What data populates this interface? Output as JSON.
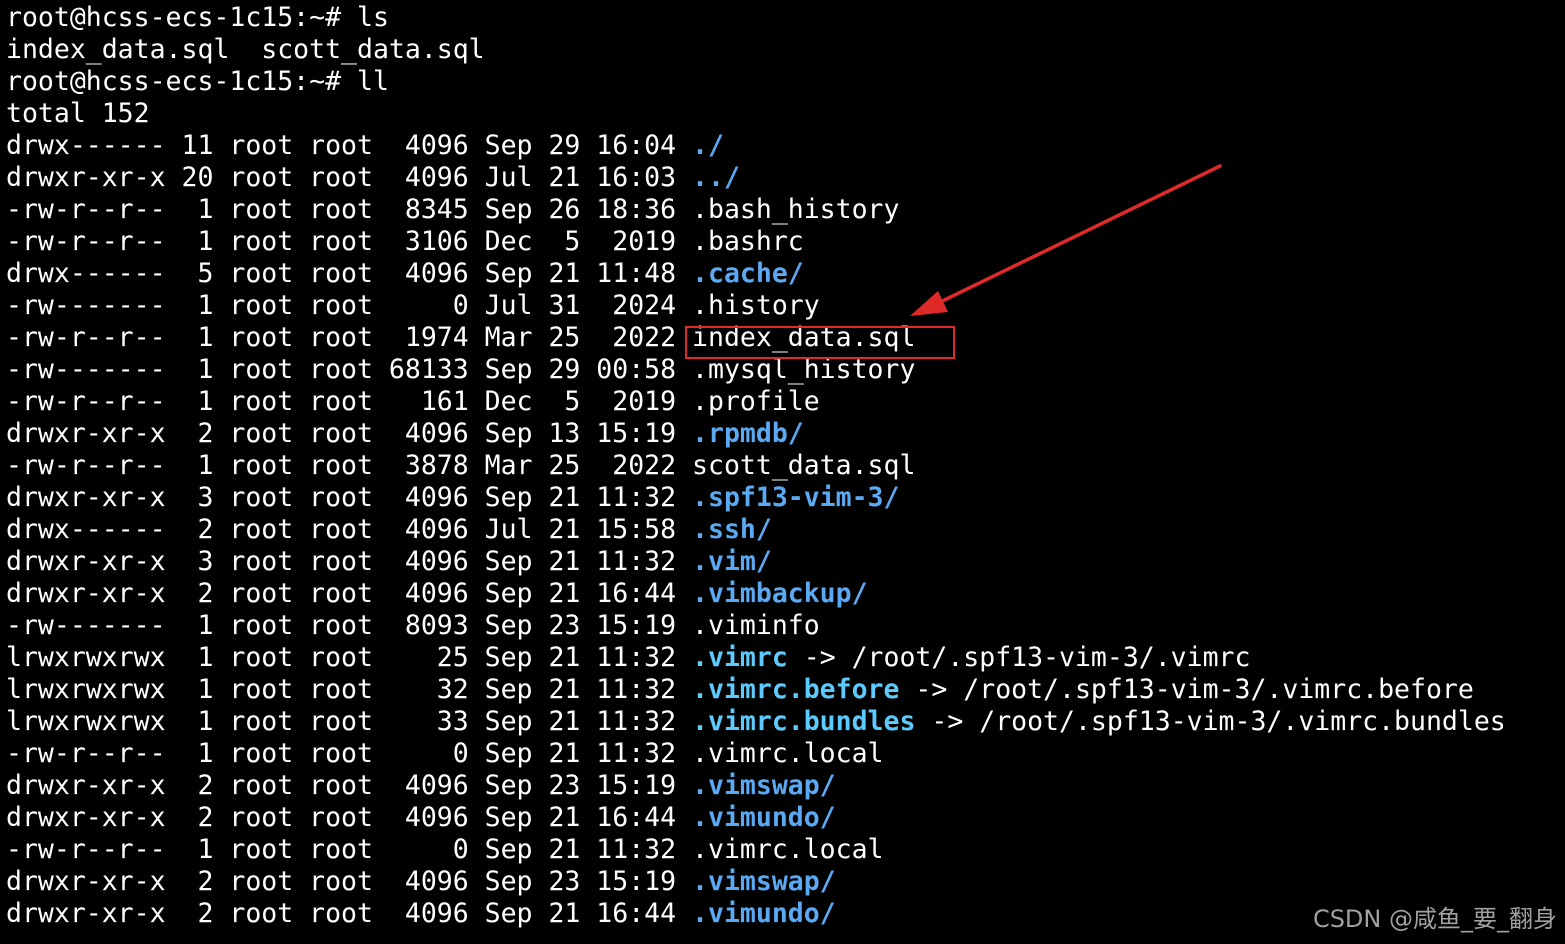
{
  "terminal": {
    "lines": [
      {
        "text": "root@hcss-ecs-1c15:~# ls"
      },
      {
        "text": "index_data.sql  scott_data.sql"
      },
      {
        "text": "root@hcss-ecs-1c15:~# ll"
      },
      {
        "text": "total 152"
      },
      {
        "meta": "drwx------ 11 root root  4096 Sep 29 16:04 ",
        "name": "./",
        "kind": "dir"
      },
      {
        "meta": "drwxr-xr-x 20 root root  4096 Jul 21 16:03 ",
        "name": "../",
        "kind": "dir"
      },
      {
        "meta": "-rw-r--r--  1 root root  8345 Sep 26 18:36 ",
        "name": ".bash_history",
        "kind": "file"
      },
      {
        "meta": "-rw-r--r--  1 root root  3106 Dec  5  2019 ",
        "name": ".bashrc",
        "kind": "file"
      },
      {
        "meta": "drwx------  5 root root  4096 Sep 21 11:48 ",
        "name": ".cache/",
        "kind": "dir"
      },
      {
        "meta": "-rw-------  1 root root     0 Jul 31  2024 ",
        "name": ".history",
        "kind": "file"
      },
      {
        "meta": "-rw-r--r--  1 root root  1974 Mar 25  2022 ",
        "name": "index_data.sql",
        "kind": "file"
      },
      {
        "meta": "-rw-------  1 root root 68133 Sep 29 00:58 ",
        "name": ".mysql_history",
        "kind": "file"
      },
      {
        "meta": "-rw-r--r--  1 root root   161 Dec  5  2019 ",
        "name": ".profile",
        "kind": "file"
      },
      {
        "meta": "drwxr-xr-x  2 root root  4096 Sep 13 15:19 ",
        "name": ".rpmdb/",
        "kind": "dir"
      },
      {
        "meta": "-rw-r--r--  1 root root  3878 Mar 25  2022 ",
        "name": "scott_data.sql",
        "kind": "file"
      },
      {
        "meta": "drwxr-xr-x  3 root root  4096 Sep 21 11:32 ",
        "name": ".spf13-vim-3/",
        "kind": "dir"
      },
      {
        "meta": "drwx------  2 root root  4096 Jul 21 15:58 ",
        "name": ".ssh/",
        "kind": "dir"
      },
      {
        "meta": "drwxr-xr-x  3 root root  4096 Sep 21 11:32 ",
        "name": ".vim/",
        "kind": "dir"
      },
      {
        "meta": "drwxr-xr-x  2 root root  4096 Sep 21 16:44 ",
        "name": ".vimbackup/",
        "kind": "dir"
      },
      {
        "meta": "-rw-------  1 root root  8093 Sep 23 15:19 ",
        "name": ".viminfo",
        "kind": "file"
      },
      {
        "meta": "lrwxrwxrwx  1 root root    25 Sep 21 11:32 ",
        "name": ".vimrc",
        "kind": "link",
        "target": " -> /root/.spf13-vim-3/.vimrc"
      },
      {
        "meta": "lrwxrwxrwx  1 root root    32 Sep 21 11:32 ",
        "name": ".vimrc.before",
        "kind": "link",
        "target": " -> /root/.spf13-vim-3/.vimrc.before"
      },
      {
        "meta": "lrwxrwxrwx  1 root root    33 Sep 21 11:32 ",
        "name": ".vimrc.bundles",
        "kind": "link",
        "target": " -> /root/.spf13-vim-3/.vimrc.bundles"
      },
      {
        "meta": "-rw-r--r--  1 root root     0 Sep 21 11:32 ",
        "name": ".vimrc.local",
        "kind": "file"
      },
      {
        "meta": "drwxr-xr-x  2 root root  4096 Sep 23 15:19 ",
        "name": ".vimswap/",
        "kind": "dir"
      },
      {
        "meta": "drwxr-xr-x  2 root root  4096 Sep 21 16:44 ",
        "name": ".vimundo/",
        "kind": "dir"
      },
      {
        "meta": "-rw-r--r--  1 root root     0 Sep 21 11:32 ",
        "name": ".vimrc.local",
        "kind": "file"
      },
      {
        "meta": "drwxr-xr-x  2 root root  4096 Sep 23 15:19 ",
        "name": ".vimswap/",
        "kind": "dir"
      },
      {
        "meta": "drwxr-xr-x  2 root root  4096 Sep 21 16:44 ",
        "name": ".vimundo/",
        "kind": "dir"
      }
    ]
  },
  "watermark": {
    "text": "CSDN @咸鱼_要_翻身"
  },
  "colors": {
    "background": "#000000",
    "text": "#ffffff",
    "directory": "#5aa9f2",
    "symlink": "#5ccbff",
    "annotation": "#e02a2a"
  }
}
